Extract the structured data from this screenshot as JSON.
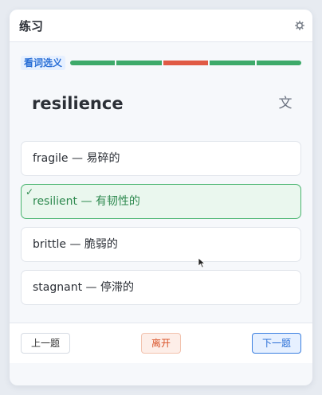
{
  "window": {
    "title": "练习"
  },
  "quiz": {
    "mode": "看词选义",
    "progress": [
      "correct",
      "correct",
      "wrong",
      "correct",
      "correct"
    ],
    "progress_colors": {
      "correct": "#3eaa6a",
      "wrong": "#e05a45"
    },
    "word": "resilience",
    "translate_glyph": "文",
    "check_glyph": "✓",
    "options": [
      {
        "text": "fragile — 易碎的",
        "state": "normal"
      },
      {
        "text": "resilient — 有韧性的",
        "state": "correct"
      },
      {
        "text": "brittle — 脆弱的",
        "state": "normal"
      },
      {
        "text": "stagnant — 停滞的",
        "state": "normal"
      }
    ]
  },
  "footer": {
    "prev_label": "上一题",
    "leave_label": "离开",
    "next_label": "下一题"
  },
  "icons": {
    "settings": "gear-icon",
    "translate": "translate-icon",
    "check": "check-icon",
    "cursor": "mouse-cursor-icon"
  }
}
